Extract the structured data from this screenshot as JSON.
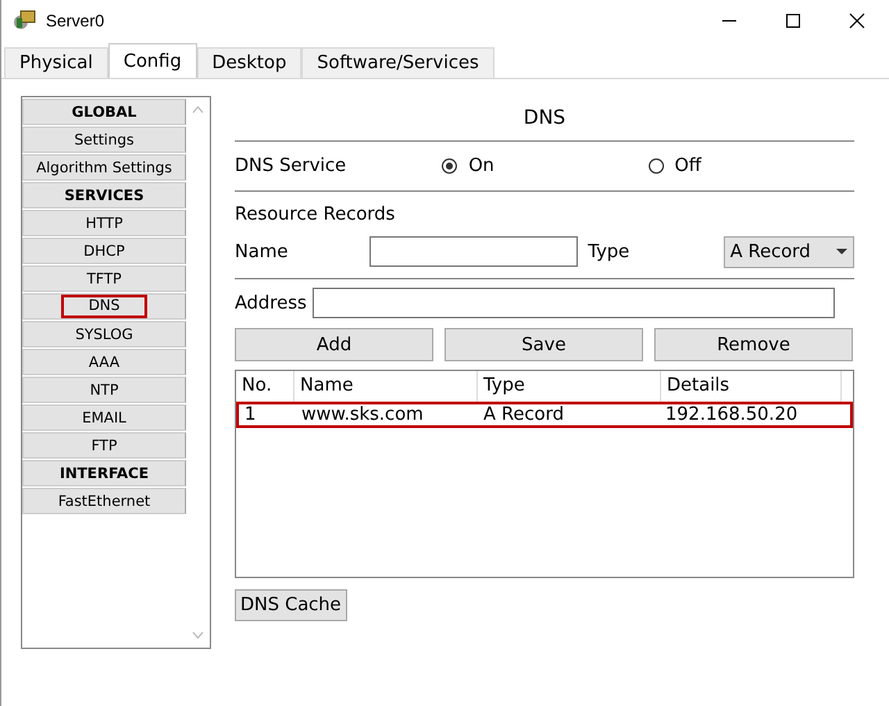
{
  "window": {
    "title": "Server0"
  },
  "tabs": [
    {
      "label": "Physical",
      "selected": false
    },
    {
      "label": "Config",
      "selected": true
    },
    {
      "label": "Desktop",
      "selected": false
    },
    {
      "label": "Software/Services",
      "selected": false
    }
  ],
  "sidebar": {
    "items": [
      {
        "label": "GLOBAL",
        "kind": "header",
        "selected": false
      },
      {
        "label": "Settings",
        "kind": "item",
        "selected": false
      },
      {
        "label": "Algorithm Settings",
        "kind": "item",
        "selected": false
      },
      {
        "label": "SERVICES",
        "kind": "header",
        "selected": false
      },
      {
        "label": "HTTP",
        "kind": "item",
        "selected": false
      },
      {
        "label": "DHCP",
        "kind": "item",
        "selected": false
      },
      {
        "label": "TFTP",
        "kind": "item",
        "selected": false
      },
      {
        "label": "DNS",
        "kind": "item",
        "selected": true
      },
      {
        "label": "SYSLOG",
        "kind": "item",
        "selected": false
      },
      {
        "label": "AAA",
        "kind": "item",
        "selected": false
      },
      {
        "label": "NTP",
        "kind": "item",
        "selected": false
      },
      {
        "label": "EMAIL",
        "kind": "item",
        "selected": false
      },
      {
        "label": "FTP",
        "kind": "item",
        "selected": false
      },
      {
        "label": "INTERFACE",
        "kind": "header",
        "selected": false
      },
      {
        "label": "FastEthernet",
        "kind": "item",
        "selected": false
      }
    ]
  },
  "panel": {
    "title": "DNS",
    "service": {
      "label": "DNS Service",
      "options": [
        {
          "label": "On",
          "selected": true
        },
        {
          "label": "Off",
          "selected": false
        }
      ]
    },
    "records_heading": "Resource Records",
    "name_label": "Name",
    "type_label": "Type",
    "type_value": "A Record",
    "address_label": "Address",
    "buttons": [
      "Add",
      "Save",
      "Remove"
    ],
    "table": {
      "columns": [
        "No.",
        "Name",
        "Type",
        "Details"
      ],
      "rows": [
        {
          "cells": [
            "1",
            "www.sks.com",
            "A Record",
            "192.168.50.20"
          ],
          "selected": true
        }
      ]
    },
    "cache_button": "DNS Cache"
  }
}
